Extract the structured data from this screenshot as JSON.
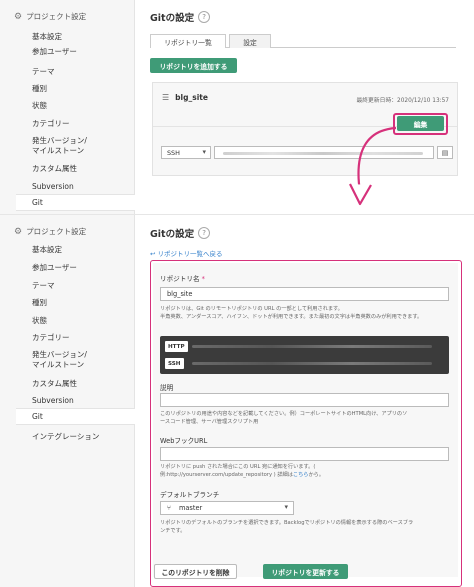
{
  "colors": {
    "accent_green": "#3f9b77",
    "highlight_pink": "#d6317b",
    "link_blue": "#2d7cc9"
  },
  "sidebar": {
    "title": "プロジェクト設定",
    "title_icon": "gear-icon",
    "items": [
      "基本設定",
      "参加ユーザー",
      "テーマ",
      "種別",
      "状態",
      "カテゴリー",
      "発生バージョン/",
      "マイルストーン",
      "カスタム属性",
      "Subversion",
      "Git"
    ],
    "extra_item": "インテグレーション"
  },
  "top": {
    "title": "Gitの設定",
    "help": "?",
    "tabs": [
      "リポジトリ一覧",
      "設定"
    ],
    "add_button": "リポジトリを追加する",
    "repo": {
      "icon": "repository-icon",
      "name": "blg_site",
      "updated": "最終更新日時：2020/12/10 13:57",
      "edit_button": "編集",
      "protocol": "SSH"
    }
  },
  "bottom": {
    "title": "Gitの設定",
    "help": "?",
    "back_link": "リポジトリ一覧へ戻る",
    "repo_name_label": "リポジトリ名",
    "required_mark": "*",
    "repo_name_value": "blg_site",
    "repo_name_help_1": "リポジトリは、Git のリモートリポジトリの URL の一部として利用されます。",
    "repo_name_help_2": "半角英数、アンダースコア、ハイフン、ドットが利用できます。また最初の文字は半角英数のみが利用できます。",
    "protocols": [
      "HTTP",
      "SSH"
    ],
    "description_label": "説明",
    "description_help_1": "このリポジトリの用途や内容などを記載してください。例）コーポレートサイトのHTML向け、アプリのソ",
    "description_help_2": "ースコード管理、サーバ管理スクリプト用",
    "webhook_label": "WebフックURL",
    "webhook_help_1": "リポジトリに push された場合にこの URL 宛に通知を行います。(",
    "webhook_help_2": "例:http://yourserver.com/update_repository ) 詳細は",
    "webhook_help_link": "こちら",
    "webhook_help_3": "から。",
    "branch_label": "デフォルトブランチ",
    "branch_icon": "branch-icon",
    "branch_value": "master",
    "branch_help_1": "リポジトリのデフォルトのブランチを選択できます。Backlogでリポジトリの情報を表示する際のベースブラ",
    "branch_help_2": "ンチです。",
    "delete_button": "このリポジトリを削除",
    "update_button": "リポジトリを更新する"
  }
}
